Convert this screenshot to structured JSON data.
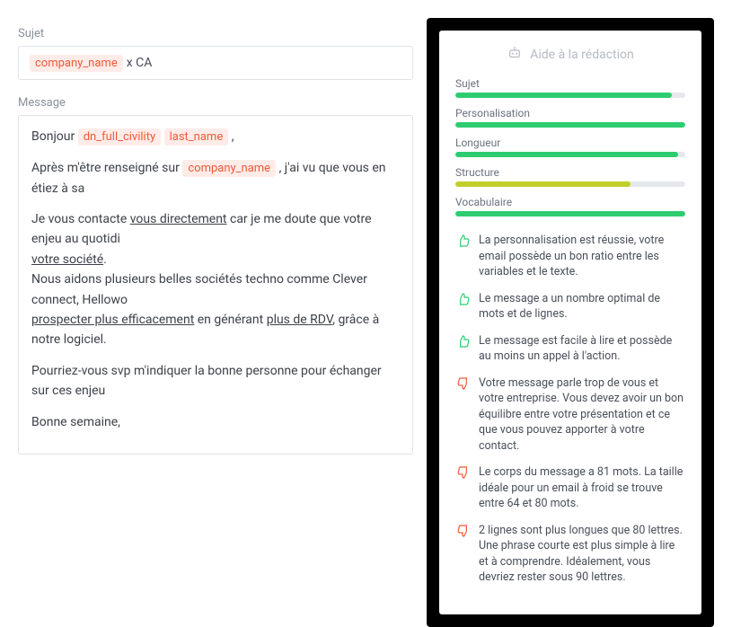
{
  "editor": {
    "subject_label": "Sujet",
    "subject_text_after": "x CA",
    "message_label": "Message",
    "token_company": "company_name",
    "token_civility": "dn_full_civility",
    "token_lastname": "last_name",
    "msg_greeting_pre": "Bonjour",
    "msg_greeting_post": ",",
    "msg_p2_a": "Après m'être renseigné sur",
    "msg_p2_b": ", j'ai vu que vous en étiez à sa",
    "msg_p3_a": "Je vous contacte ",
    "msg_p3_ul1": "vous directement",
    "msg_p3_b": " car je me doute que votre enjeu au quotidi",
    "msg_p3_ul2": "votre société",
    "msg_p3_c": ".",
    "msg_p4_a": "Nous aidons plusieurs belles sociétés techno comme Clever connect, Hellowo",
    "msg_p4_ul1": "prospecter plus efficacement",
    "msg_p4_b": " en générant ",
    "msg_p4_ul2": "plus de RDV",
    "msg_p4_c": ", grâce à notre logiciel.",
    "msg_p5": "Pourriez-vous svp m'indiquer la bonne personne pour échanger sur ces enjeu",
    "msg_p6": "Bonne semaine,"
  },
  "assist": {
    "title": "Aide à la rédaction",
    "scores": [
      {
        "label": "Sujet",
        "pct": 94,
        "color": "#2ecc71"
      },
      {
        "label": "Personalisation",
        "pct": 100,
        "color": "#2ecc71"
      },
      {
        "label": "Longueur",
        "pct": 97,
        "color": "#2ecc71"
      },
      {
        "label": "Structure",
        "pct": 76,
        "color": "#c1cf2a"
      },
      {
        "label": "Vocabulaire",
        "pct": 100,
        "color": "#2ecc71"
      }
    ],
    "feedback": [
      {
        "kind": "up",
        "text": "La personnalisation est réussie, votre email possède un bon ratio entre les variables et le texte."
      },
      {
        "kind": "up",
        "text": "Le message a un nombre optimal de mots et de lignes."
      },
      {
        "kind": "up",
        "text": "Le message est facile à lire et possède au moins un appel à l'action."
      },
      {
        "kind": "down",
        "text": "Votre message parle trop de vous et votre entreprise. Vous devez avoir un bon équilibre entre votre présentation et ce que vous pouvez apporter à votre contact."
      },
      {
        "kind": "down",
        "text": "Le corps du message a 81 mots. La taille idéale pour un email à froid se trouve entre 64 et 80 mots."
      },
      {
        "kind": "down",
        "text": "2 lignes sont plus longues que 80 lettres. Une phrase courte est plus simple à lire et à comprendre. Idéalement, vous devriez rester sous 90 lettres."
      }
    ]
  }
}
